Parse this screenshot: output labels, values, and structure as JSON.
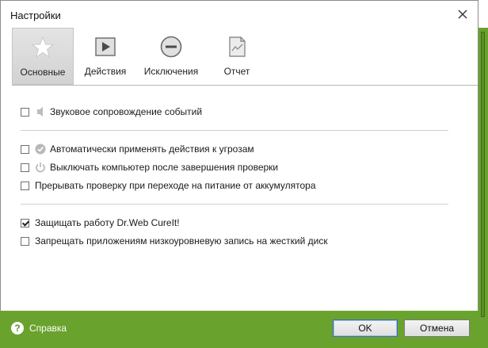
{
  "window": {
    "title": "Настройки"
  },
  "tabs": [
    {
      "label": "Основные",
      "icon": "star-icon",
      "active": true
    },
    {
      "label": "Действия",
      "icon": "play-icon",
      "active": false
    },
    {
      "label": "Исключения",
      "icon": "minus-circle-icon",
      "active": false
    },
    {
      "label": "Отчет",
      "icon": "report-icon",
      "active": false
    }
  ],
  "options": [
    {
      "label": "Звуковое сопровождение событий",
      "checked": false,
      "icon": "speaker-icon"
    },
    {
      "label": "Автоматически применять действия к угрозам",
      "checked": false,
      "icon": "checkmark-circle-icon"
    },
    {
      "label": "Выключать компьютер после завершения проверки",
      "checked": false,
      "icon": "power-icon"
    },
    {
      "label": "Прерывать проверку при переходе на питание от аккумулятора",
      "checked": false,
      "icon": ""
    },
    {
      "label": "Защищать работу Dr.Web CureIt!",
      "checked": true,
      "icon": ""
    },
    {
      "label": "Запрещать приложениям низкоуровневую запись на жесткий диск",
      "checked": false,
      "icon": ""
    }
  ],
  "footer": {
    "help_label": "Справка",
    "ok_label": "OK",
    "cancel_label": "Отмена"
  },
  "colors": {
    "accent": "#6aa22e"
  }
}
